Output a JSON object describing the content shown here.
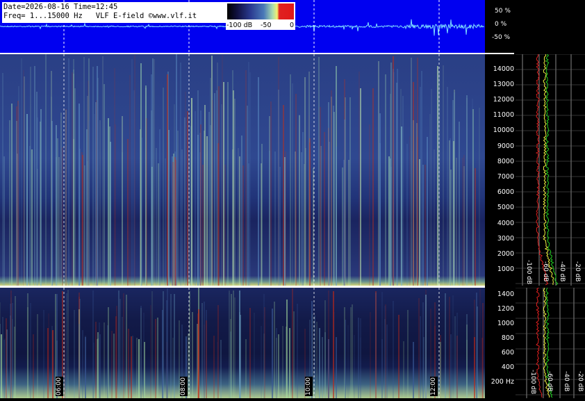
{
  "header": {
    "line1": "Date=2026-08-16 Time=12:45",
    "line2": "Freq= 1...15000 Hz   VLF E-field ©www.vlf.it"
  },
  "color_scale": {
    "labels": [
      "-100 dB",
      "-50",
      "0"
    ]
  },
  "waveform_axis": {
    "labels": [
      "50 %",
      "0 %",
      "-50 %"
    ]
  },
  "freq_axis_top": [
    "14000",
    "13000",
    "12000",
    "11000",
    "10000",
    "9000",
    "8000",
    "7000",
    "6000",
    "5000",
    "4000",
    "3000",
    "2000",
    "1000"
  ],
  "freq_axis_bottom": [
    "1400",
    "1200",
    "1000",
    "800",
    "600",
    "400",
    "200 Hz"
  ],
  "time_markers": [
    "06:00",
    "08:00",
    "10:00",
    "12:00"
  ],
  "profile_top_labels": [
    "-100 dB",
    "-60 dB",
    "-40 dB",
    "-20 dB"
  ],
  "profile_bottom_labels": [
    "-100 dB",
    "-60 dB",
    "-40 dB",
    "-20 dB"
  ],
  "colors": {
    "wave_bg": "#0000f0",
    "wave_trace": "#7fe0ff",
    "spectrum_line": "#ffffff",
    "profile_avg": "#f0f040",
    "profile_min": "#e02020",
    "profile_max": "#20d020"
  }
}
